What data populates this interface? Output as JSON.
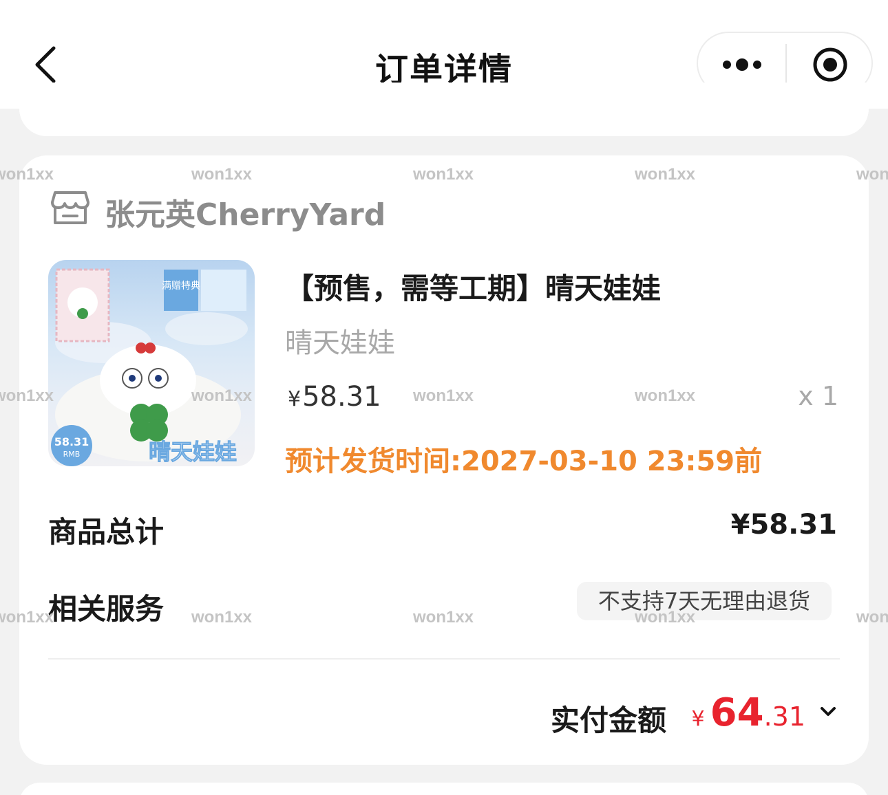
{
  "header": {
    "title": "订单详情",
    "back_icon": "chevron-left-icon",
    "more_icon": "more-dots-icon",
    "close_icon": "target-circle-icon"
  },
  "store": {
    "icon": "store-icon",
    "name": "张元英CherryYard"
  },
  "product": {
    "image_icon": "product-thumbnail",
    "image_text": {
      "badge_top": "满赠特典",
      "price_badge": "58.31",
      "price_badge_unit": "RMB",
      "caption": "晴天娃娃"
    },
    "title": "【预售，需等工期】晴天娃娃",
    "spec": "晴天娃娃",
    "price_symbol": "¥",
    "price": "58.31",
    "quantity": "x 1",
    "ship_time": "预计发货时间:2027-03-10 23:59前"
  },
  "summary": {
    "subtotal_label": "商品总计",
    "subtotal_value": "¥58.31",
    "service_label": "相关服务",
    "service_tag": "不支持7天无理由退货",
    "paid_label": "实付金额",
    "paid_symbol": "¥",
    "paid_int": "64",
    "paid_dec": ".31",
    "expand_icon": "chevron-down-icon"
  },
  "watermark": "won1xx",
  "colors": {
    "accent_red": "#e8232e",
    "ship_orange": "#f0892e",
    "muted_gray": "#a8a8a8",
    "background": "#f2f2f2"
  }
}
